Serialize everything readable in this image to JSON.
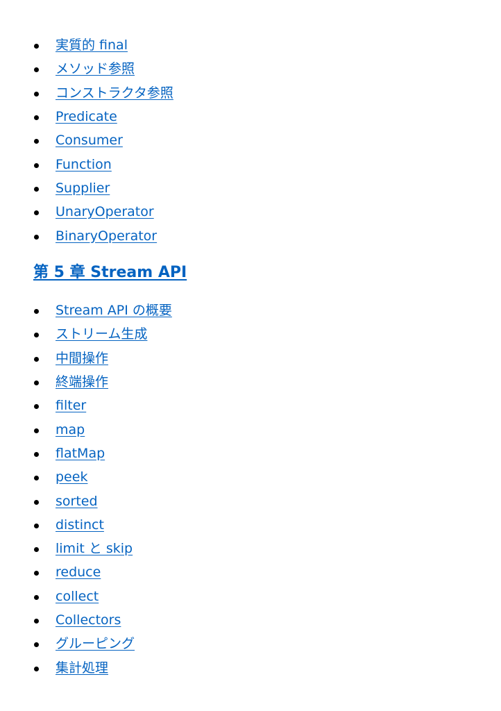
{
  "section_a": {
    "items": [
      "実質的 final",
      "メソッド参照",
      "コンストラクタ参照",
      "Predicate",
      "Consumer",
      "Function",
      "Supplier",
      "UnaryOperator",
      "BinaryOperator"
    ]
  },
  "chapter5": {
    "title": "第 5 章 Stream API",
    "items": [
      "Stream API の概要",
      "ストリーム生成",
      "中間操作",
      "終端操作",
      "filter",
      "map",
      "flatMap",
      "peek",
      "sorted",
      "distinct",
      "limit と skip",
      "reduce",
      "collect",
      "Collectors",
      "グルーピング",
      "集計処理"
    ]
  },
  "colors": {
    "link": "#0563C1",
    "bullet": "#000000",
    "background": "#FFFFFF"
  }
}
